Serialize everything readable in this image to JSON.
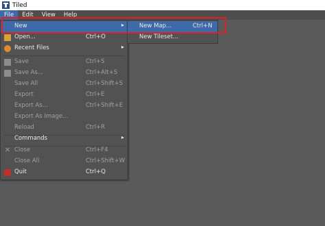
{
  "window": {
    "title": "Tiled"
  },
  "menubar": {
    "file": "File",
    "edit": "Edit",
    "view": "View",
    "help": "Help"
  },
  "file_menu": {
    "new": "New",
    "open": "Open...",
    "open_sc": "Ctrl+O",
    "recent": "Recent Files",
    "save": "Save",
    "save_sc": "Ctrl+S",
    "save_as": "Save As...",
    "save_as_sc": "Ctrl+Alt+S",
    "save_all": "Save All",
    "save_all_sc": "Ctrl+Shift+S",
    "export": "Export",
    "export_sc": "Ctrl+E",
    "export_as": "Export As...",
    "export_as_sc": "Ctrl+Shift+E",
    "export_as_image": "Export As Image...",
    "reload": "Reload",
    "reload_sc": "Ctrl+R",
    "commands": "Commands",
    "close": "Close",
    "close_sc": "Ctrl+F4",
    "close_all": "Close All",
    "close_all_sc": "Ctrl+Shift+W",
    "quit": "Quit",
    "quit_sc": "Ctrl+Q"
  },
  "new_submenu": {
    "new_map": "New Map...",
    "new_map_sc": "Ctrl+N",
    "new_tileset": "New Tileset..."
  },
  "colors": {
    "highlight": "#3d6aa8",
    "annotation": "#e01e24"
  }
}
